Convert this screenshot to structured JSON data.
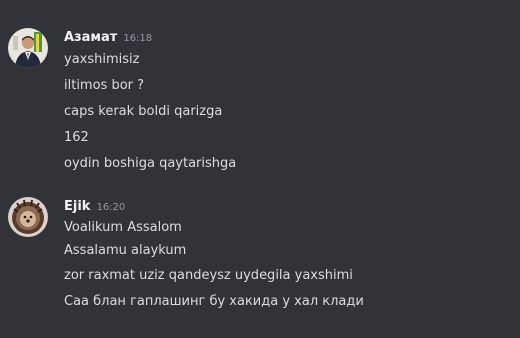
{
  "channel": {
    "messages": [
      {
        "author": "Азамат",
        "time": "16:18",
        "avatar_icon": "user-photo-avatar",
        "lines": [
          "yaxshimisiz",
          "iltimos bor ?",
          "caps kerak boldi qarizga",
          "162",
          "oydin boshiga qaytarishga"
        ]
      },
      {
        "author": "Ejik",
        "time": "16:20",
        "avatar_icon": "hedgehog-avatar",
        "lines": [
          "Voalikum Assalom",
          "Assalamu alaykum",
          "zor raxmat uziz qandeysz uydegila yaxshimi",
          "Саа блан гаплашинг бу хакида у хал клади"
        ]
      }
    ]
  },
  "colors": {
    "background": "#313338",
    "text": "#dbdee1",
    "username": "#f2f3f5",
    "timestamp": "#949ba4"
  }
}
